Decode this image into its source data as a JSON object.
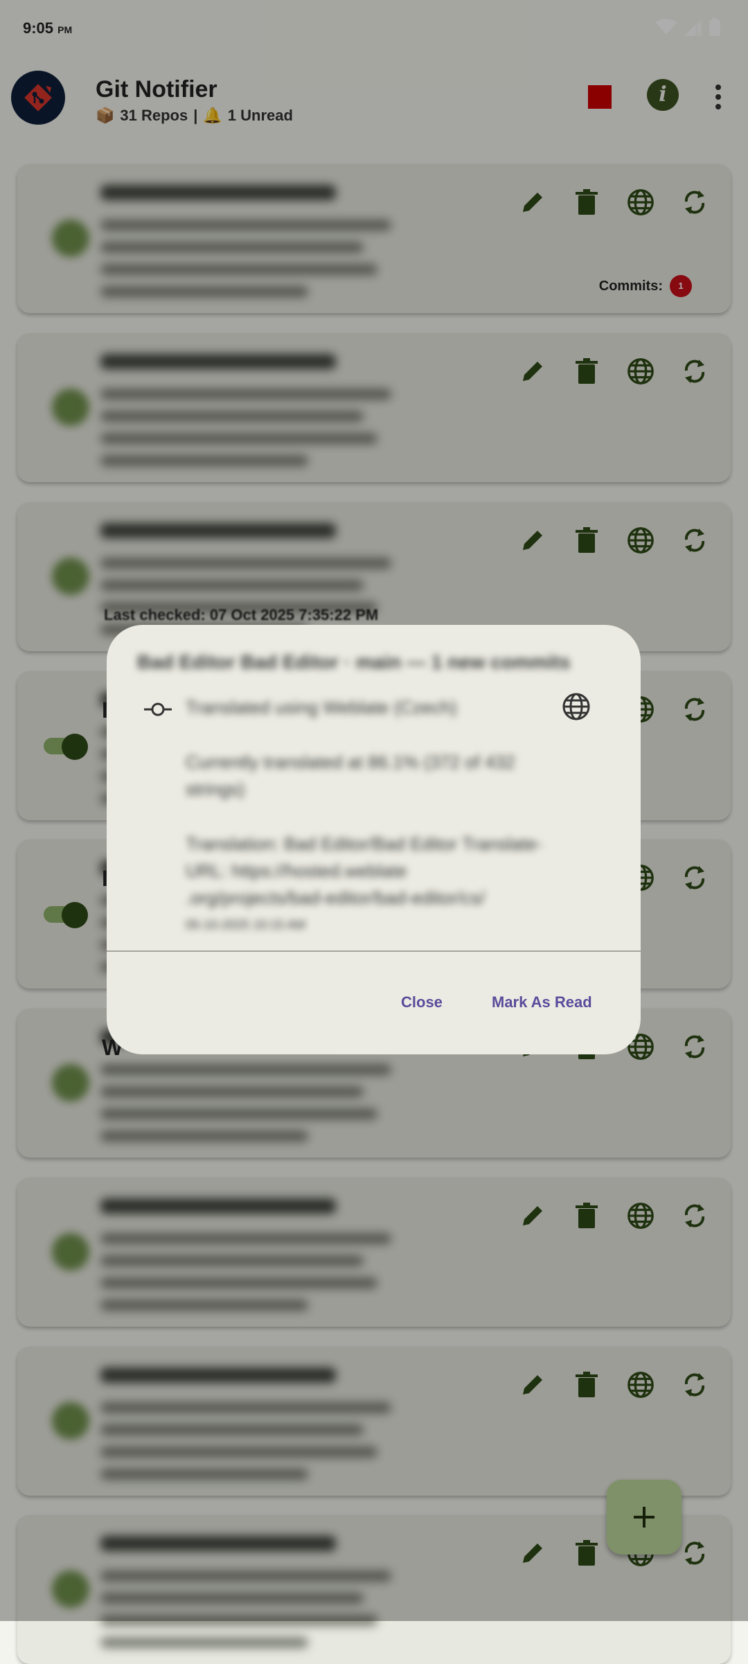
{
  "status_bar": {
    "time": "9:05",
    "ampm": "PM"
  },
  "app": {
    "title": "Git Notifier",
    "repos_text": "31 Repos",
    "separator": "|",
    "unread_text": "1 Unread"
  },
  "cards": [
    {
      "letter": "",
      "commits_label": "Commits:",
      "commits_count": "1",
      "has_toggle": false
    },
    {
      "letter": "",
      "has_toggle": false
    },
    {
      "letter": "",
      "last_checked": "Last checked: 07 Oct 2025 7:35:22 PM",
      "has_toggle": false
    },
    {
      "letter": "I",
      "has_toggle": true
    },
    {
      "letter": "I",
      "has_toggle": true
    },
    {
      "letter": "W",
      "has_toggle": false
    },
    {
      "letter": "",
      "has_toggle": false
    },
    {
      "letter": "",
      "has_toggle": false
    },
    {
      "letter": "",
      "has_toggle": false
    }
  ],
  "dialog": {
    "title": "Bad Editor Bad Editor · main — 1 new commits",
    "message_lines": [
      "Translated using Weblate (Czech)",
      "Currently translated at 86.1% (372 of 432 strings)",
      "Translation: Bad Editor/Bad Editor Translate-URL: https://hosted.weblate .org/projects/bad-editor/bad-editor/cs/"
    ],
    "date": "05-10-2025 10:15 AM",
    "close_label": "Close",
    "mark_read_label": "Mark As Read"
  },
  "colors": {
    "accent": "#3b5321",
    "stop": "#cc0000",
    "badge": "#c8101a",
    "dialog_button": "#5b4b9b",
    "fab": "#bcd69a"
  }
}
